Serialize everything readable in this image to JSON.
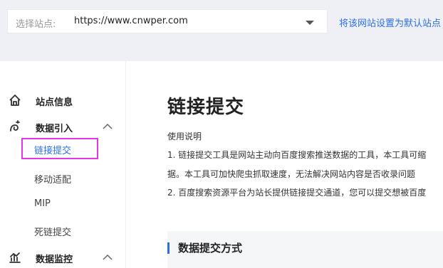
{
  "topbar": {
    "site_label": "选择站点:",
    "site_value": "https://www.cnwper.com",
    "set_default_link": "将该网站设置为默认站点"
  },
  "sidebar": {
    "sections": [
      {
        "label": "站点信息",
        "icon": "home-icon"
      },
      {
        "label": "数据引入",
        "icon": "data-import-icon",
        "expanded": true
      },
      {
        "label": "数据监控",
        "icon": "chart-icon",
        "expanded": true
      }
    ],
    "sub_items": [
      "链接提交",
      "移动适配",
      "MIP",
      "死链提交"
    ],
    "active_item": "链接提交"
  },
  "main": {
    "title": "链接提交",
    "usage_heading": "使用说明",
    "lines": [
      "1. 链接提交工具是网站主动向百度搜索推送数据的工具，本工具可缩",
      "据。本工具可加快爬虫抓取速度，无法解决网站内容是否收录问题",
      "2. 百度搜索资源平台为站长提供链接提交通道，您可以提交想被百度"
    ],
    "section_title": "数据提交方式"
  },
  "colors": {
    "accent": "#2d6fe8",
    "highlight": "#e635e6",
    "background": "#eef0f5"
  }
}
